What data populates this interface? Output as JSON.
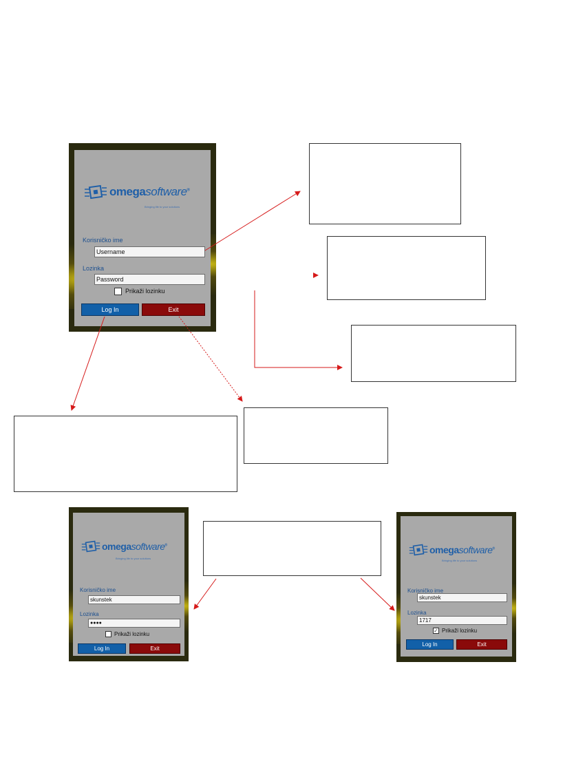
{
  "logo": {
    "brand_bold": "omega",
    "brand_light": "software",
    "registered": "®",
    "tagline": "Bringing life to your solutions"
  },
  "screens": {
    "main": {
      "username_label": "Korisničko ime",
      "username_value": "Username",
      "password_label": "Lozinka",
      "password_value": "Password",
      "show_password_label": "Prikaži lozinku",
      "show_password_checked": false,
      "login_label": "Log In",
      "exit_label": "Exit"
    },
    "masked": {
      "username_label": "Korisničko ime",
      "username_value": "skunstek",
      "password_label": "Lozinka",
      "password_value": "●●●●",
      "show_password_label": "Prikaži lozinku",
      "show_password_checked": false,
      "login_label": "Log In",
      "exit_label": "Exit"
    },
    "revealed": {
      "username_label": "Korisničko ime",
      "username_value": "skunstek",
      "password_label": "Lozinka",
      "password_value": "1717",
      "show_password_label": "Prikaži lozinku",
      "show_password_checked": true,
      "check_mark": "✓",
      "login_label": "Log In",
      "exit_label": "Exit"
    }
  },
  "colors": {
    "login_button": "#1260a8",
    "exit_button": "#8a0a0a",
    "panel": "#a9a9a9",
    "frame": "#2a2a0f",
    "arrow": "#d61a1a",
    "label_blue": "#1c4f8f"
  }
}
